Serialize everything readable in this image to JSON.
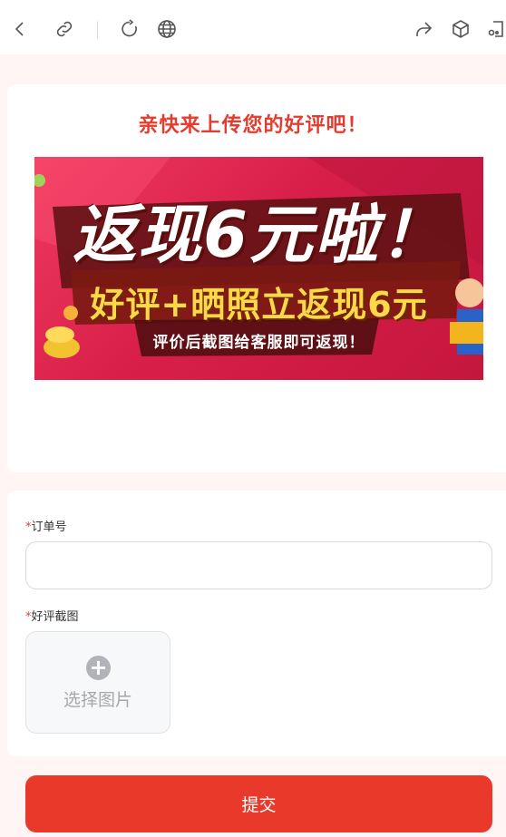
{
  "toolbar": {
    "icons": [
      "back-icon",
      "link-icon",
      "refresh-icon",
      "globe-icon",
      "share-icon",
      "cube-icon",
      "more-icon"
    ]
  },
  "promo": {
    "headline": "亲快来上传您的好评吧！",
    "banner_line1": "返现6元啦！",
    "banner_line2": "好评+晒照立返现6元",
    "banner_line3": "评价后截图给客服即可返现！"
  },
  "form": {
    "required_mark": "*",
    "order_label": "订单号",
    "order_value": "",
    "screenshot_label": "好评截图",
    "upload_plus": "+",
    "upload_label": "选择图片",
    "submit_label": "提交"
  },
  "colors": {
    "accent": "#e8392b",
    "headline": "#e53c2f",
    "page_bg": "#fff5f5"
  }
}
